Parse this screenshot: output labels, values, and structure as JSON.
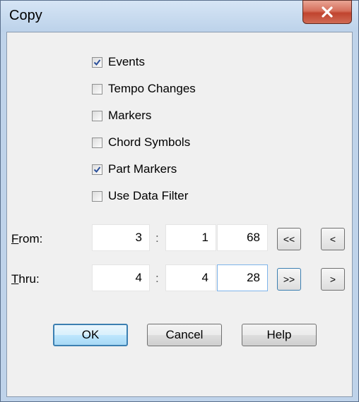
{
  "window": {
    "title": "Copy"
  },
  "checkboxes": [
    {
      "label": "Events",
      "checked": true
    },
    {
      "label": "Tempo Changes",
      "checked": false
    },
    {
      "label": "Markers",
      "checked": false
    },
    {
      "label": "Chord Symbols",
      "checked": false
    },
    {
      "label": "Part Markers",
      "checked": true
    },
    {
      "label": "Use Data Filter",
      "checked": false
    }
  ],
  "from": {
    "label_prefix": "F",
    "label_rest": "rom:",
    "bar": "3",
    "beat": "1",
    "tick": "68"
  },
  "thru": {
    "label_prefix": "T",
    "label_rest": "hru:",
    "bar": "4",
    "beat": "4",
    "tick": "28"
  },
  "separators": {
    "colon": ":"
  },
  "nav": {
    "rewind": "<<",
    "back": "<",
    "forward_end": ">>",
    "forward": ">"
  },
  "buttons": {
    "ok": "OK",
    "cancel": "Cancel",
    "help": "Help"
  }
}
